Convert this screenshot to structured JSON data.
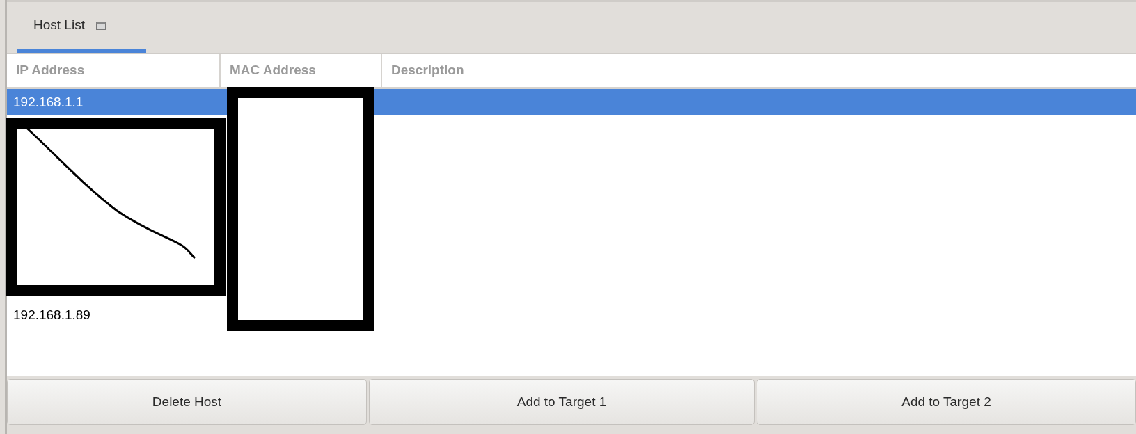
{
  "tabs": [
    {
      "label": "Host List",
      "selected": true
    }
  ],
  "table": {
    "columns": [
      "IP Address",
      "MAC Address",
      "Description"
    ],
    "rows": [
      {
        "ip": "192.168.1.1",
        "selected": true
      },
      {
        "ip": "192.168.1.89",
        "selected": false
      }
    ]
  },
  "buttons": [
    "Delete Host",
    "Add to Target 1",
    "Add to Target 2"
  ]
}
